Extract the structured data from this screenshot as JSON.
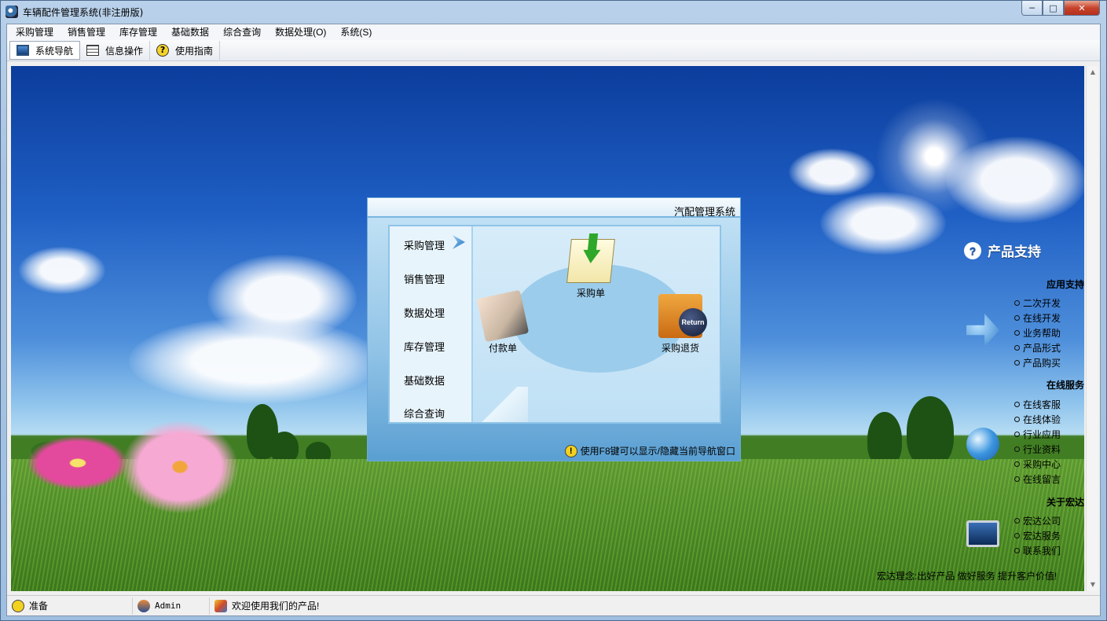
{
  "window": {
    "title": "车辆配件管理系统(非注册版)",
    "controls": {
      "minimize": "─",
      "maximize": "□",
      "close": "✕"
    }
  },
  "menubar": {
    "items": [
      "采购管理",
      "销售管理",
      "库存管理",
      "基础数据",
      "综合查询",
      "数据处理(O)",
      "系统(S)"
    ]
  },
  "toolbar": {
    "items": [
      {
        "label": "系统导航",
        "icon": "monitor-icon"
      },
      {
        "label": "信息操作",
        "icon": "grid-icon"
      },
      {
        "label": "使用指南",
        "icon": "help-icon"
      }
    ]
  },
  "nav_panel": {
    "title": "汽配管理系统",
    "side_items": [
      "采购管理",
      "销售管理",
      "数据处理",
      "库存管理",
      "基础数据",
      "综合查询"
    ],
    "functions": [
      {
        "label": "采购单",
        "icon": "purchase-order-icon"
      },
      {
        "label": "付款单",
        "icon": "payment-icon"
      },
      {
        "label": "采购退货",
        "icon": "purchase-return-icon"
      }
    ],
    "return_badge": "Return",
    "tip": "使用F8键可以显示/隐藏当前导航窗口"
  },
  "support": {
    "title": "产品支持",
    "sections": [
      {
        "title": "应用支持",
        "links": [
          "二次开发",
          "在线开发",
          "业务帮助",
          "产品形式",
          "产品购买"
        ]
      },
      {
        "title": "在线服务",
        "links": [
          "在线客服",
          "在线体验",
          "行业应用",
          "行业资料",
          "采购中心",
          "在线留言"
        ]
      },
      {
        "title": "关于宏达",
        "links": [
          "宏达公司",
          "宏达服务",
          "联系我们"
        ]
      }
    ],
    "slogan": "宏达理念:出好产品 做好服务 提升客户价值!"
  },
  "statusbar": {
    "ready": "准备",
    "user": "Admin",
    "welcome": "欢迎使用我们的产品!"
  },
  "colors": {
    "sky_top": "#0b3d9c",
    "grass": "#4c8a22",
    "panel_blue": "#8fc2e6"
  }
}
